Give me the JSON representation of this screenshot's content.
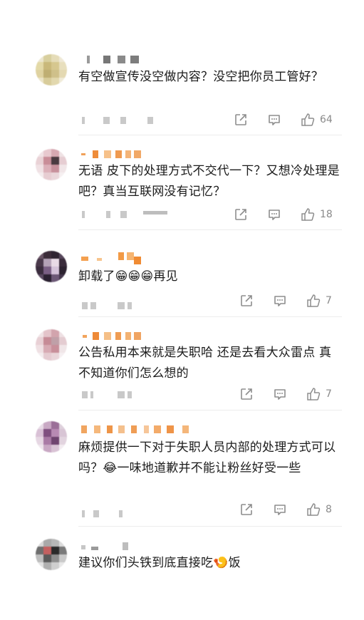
{
  "comments": [
    {
      "text": "有空做宣传没空做内容？没空把你员工管好？",
      "likes": "64"
    },
    {
      "text": "无语 皮下的处理方式不交代一下？又想冷处理是吧？真当互联网没有记忆？",
      "likes": "18"
    },
    {
      "text": "卸载了😁😁😁再见",
      "likes": "7"
    },
    {
      "text": "公告私用本来就是失职哈 还是去看大众雷点 真不知道你们怎么想的",
      "likes": "7"
    },
    {
      "text": "麻烦提供一下对于失职人员内部的处理方式可以吗？😂一味地道歉并不能让粉丝好受一些",
      "likes": "8"
    },
    {
      "text": "建议你们头铁到底直接吃🍤饭"
    }
  ],
  "icons": {
    "share": "share-icon",
    "reply": "comment-icon",
    "like": "thumbs-up-icon"
  }
}
